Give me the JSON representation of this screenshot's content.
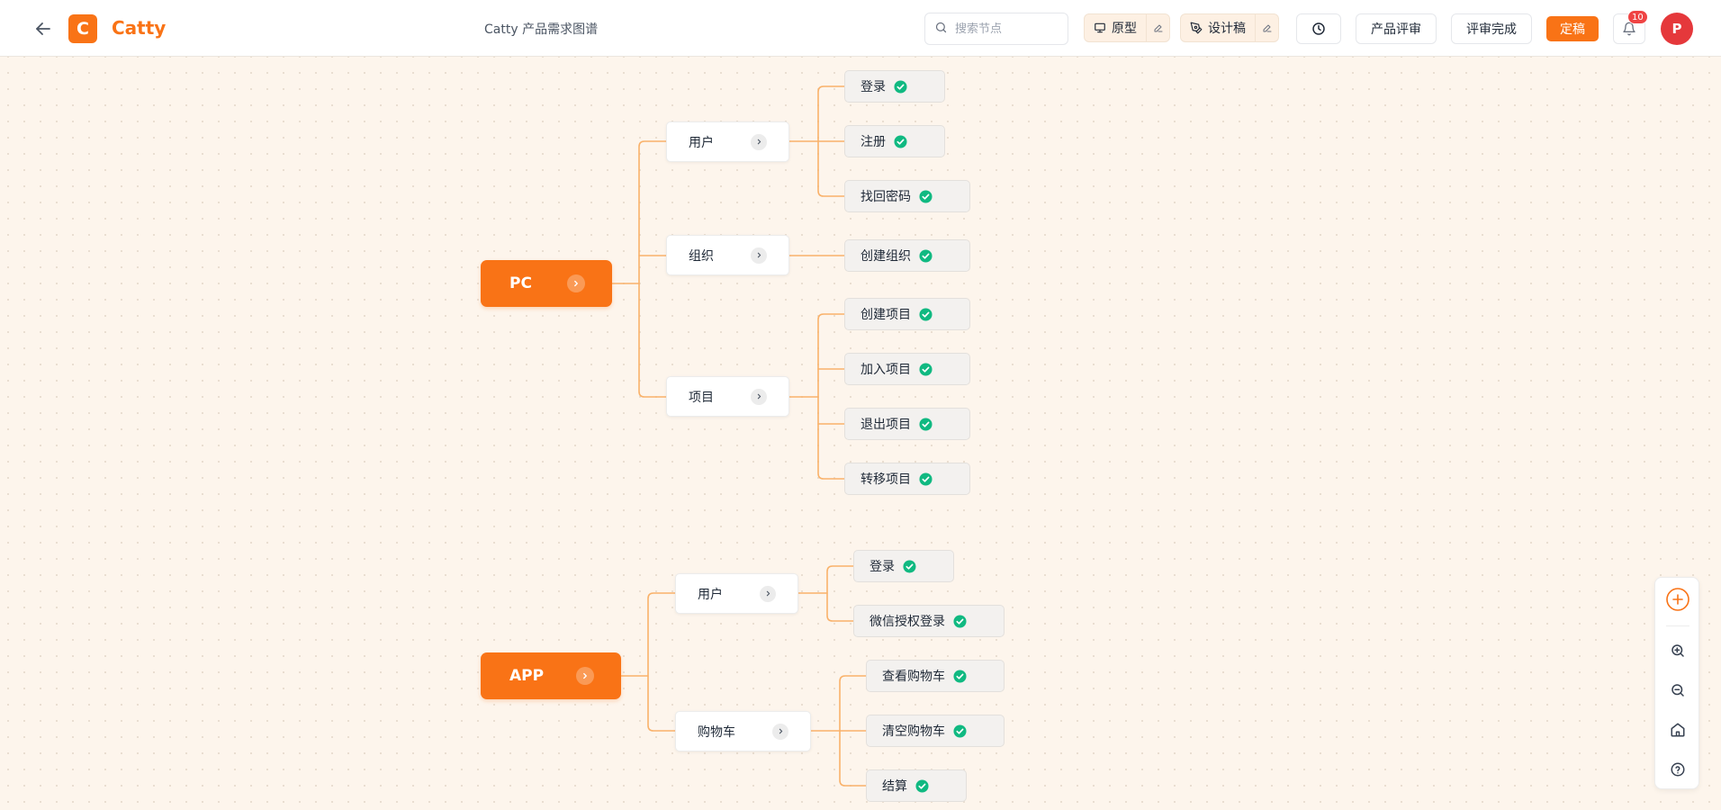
{
  "header": {
    "app_logo_letter": "C",
    "app_name": "Catty",
    "doc_title": "Catty 产品需求图谱",
    "search_placeholder": "搜索节点",
    "prototype_label": "原型",
    "design_label": "设计稿",
    "review_label": "产品评审",
    "review_done_label": "评审完成",
    "finalize_label": "定稿",
    "notification_count": "10",
    "avatar_letter": "P"
  },
  "colors": {
    "accent": "#f97316",
    "connector": "#f9b26b",
    "check": "#10b981",
    "badge": "#ef4444",
    "avatar": "#e5383b"
  },
  "mindmap": {
    "pc": {
      "label": "PC",
      "user": {
        "label": "用户",
        "children": [
          "登录",
          "注册",
          "找回密码"
        ]
      },
      "org": {
        "label": "组织",
        "children": [
          "创建组织"
        ]
      },
      "project": {
        "label": "项目",
        "children": [
          "创建项目",
          "加入项目",
          "退出项目",
          "转移项目"
        ]
      }
    },
    "app": {
      "label": "APP",
      "user": {
        "label": "用户",
        "children": [
          "登录",
          "微信授权登录"
        ]
      },
      "cart": {
        "label": "购物车",
        "children": [
          "查看购物车",
          "清空购物车",
          "结算"
        ]
      }
    }
  }
}
